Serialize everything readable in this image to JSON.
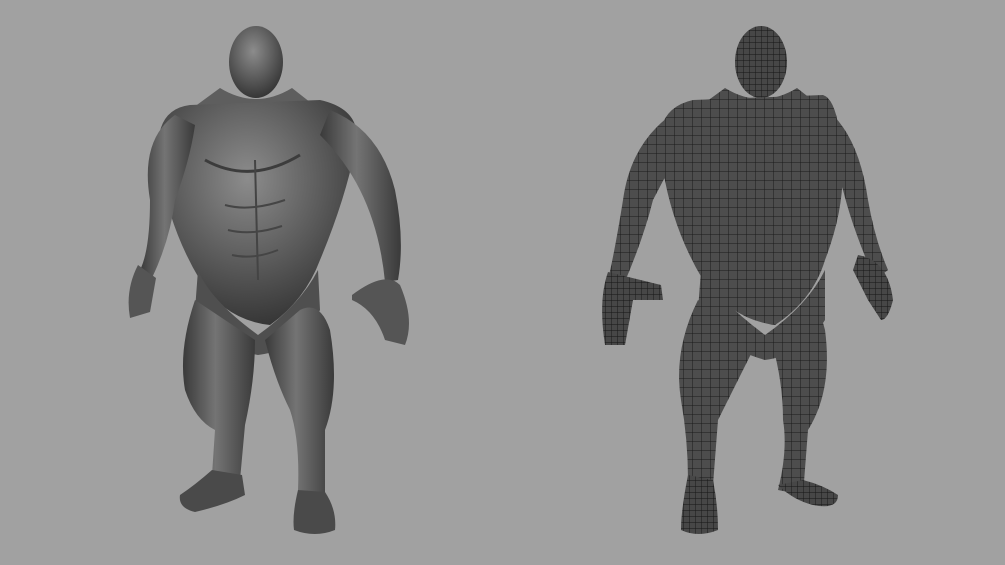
{
  "viewport": {
    "background": "#a1a1a1",
    "panels": [
      {
        "view": "smooth-shaded",
        "shade": "#5a5a5a",
        "shade_light": "#8c8c8c",
        "shade_dark": "#2e2e2e"
      },
      {
        "view": "wireframe-on-shaded",
        "shade": "#4b4b4b",
        "wire": "#1a1a1a"
      }
    ]
  }
}
